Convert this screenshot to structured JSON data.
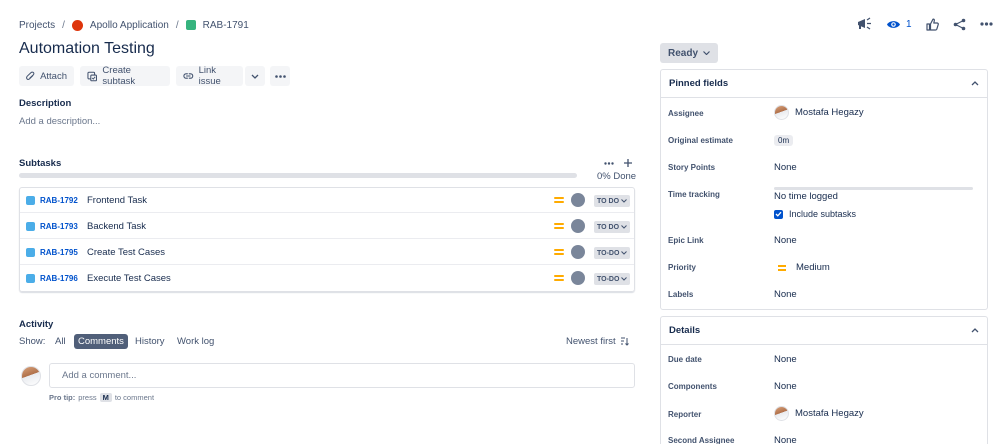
{
  "breadcrumb": {
    "projects": "Projects",
    "project": "Apollo Application",
    "issue": "RAB-1791"
  },
  "top_actions": {
    "watch_count": "1"
  },
  "issue": {
    "title": "Automation Testing"
  },
  "toolbar": {
    "attach": "Attach",
    "create_subtask": "Create subtask",
    "link_issue": "Link issue"
  },
  "description": {
    "heading": "Description",
    "placeholder": "Add a description..."
  },
  "subtasks": {
    "heading": "Subtasks",
    "progress_label": "0% Done",
    "progress_fraction": 0,
    "items": [
      {
        "key": "RAB-1792",
        "summary": "Frontend Task",
        "status": "TO DO"
      },
      {
        "key": "RAB-1793",
        "summary": "Backend Task",
        "status": "TO DO"
      },
      {
        "key": "RAB-1795",
        "summary": "Create Test Cases",
        "status": "TO-DO"
      },
      {
        "key": "RAB-1796",
        "summary": "Execute Test Cases",
        "status": "TO-DO"
      }
    ]
  },
  "activity": {
    "heading": "Activity",
    "show_label": "Show:",
    "filters": [
      "All",
      "Comments",
      "History",
      "Work log"
    ],
    "active_filter": "Comments",
    "sort": "Newest first",
    "comment_placeholder": "Add a comment...",
    "protip_bold": "Pro tip:",
    "protip_pre": "press",
    "protip_key": "M",
    "protip_post": "to comment"
  },
  "status_button": "Ready",
  "pinned": {
    "heading": "Pinned fields",
    "assignee_label": "Assignee",
    "assignee": "Mostafa Hegazy",
    "estimate_label": "Original estimate",
    "estimate": "0m",
    "story_points_label": "Story Points",
    "story_points": "None",
    "time_tracking_label": "Time tracking",
    "time_tracking": "No time logged",
    "include_subtasks": "Include subtasks",
    "epic_label": "Epic Link",
    "epic": "None",
    "priority_label": "Priority",
    "priority": "Medium",
    "labels_label": "Labels",
    "labels": "None"
  },
  "details": {
    "heading": "Details",
    "due_label": "Due date",
    "due": "None",
    "components_label": "Components",
    "components": "None",
    "reporter_label": "Reporter",
    "reporter": "Mostafa Hegazy",
    "second_assignee_label": "Second Assignee",
    "second_assignee": "None"
  },
  "colors": {
    "accent": "#0052cc",
    "priority_medium": "#ffab00",
    "subtask_icon": "#4bade8",
    "story_icon": "#36b37e",
    "project_icon": "#de350b"
  }
}
